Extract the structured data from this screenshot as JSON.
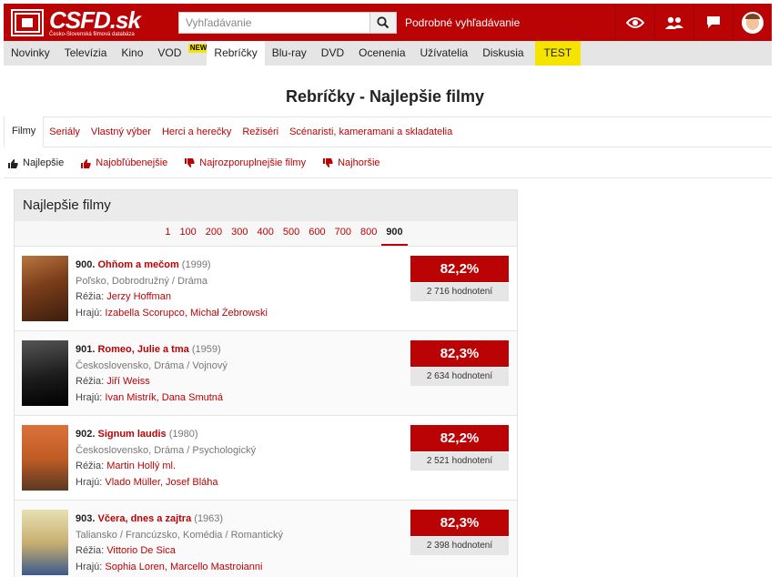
{
  "header": {
    "logo_text": "CSFD.sk",
    "logo_sub": "Česko-Slovenská filmová databáza",
    "search_placeholder": "Vyhľadávanie",
    "advanced_search": "Podrobné vyhľadávanie",
    "icons": [
      "eye-icon",
      "users-icon",
      "chat-icon",
      "avatar"
    ]
  },
  "nav": {
    "items": [
      "Novinky",
      "Televízia",
      "Kino",
      "VOD",
      "Rebríčky",
      "Blu-ray",
      "DVD",
      "Ocenenia",
      "Užívatelia",
      "Diskusia",
      "TEST"
    ],
    "vod_badge": "NEW",
    "active": "Rebríčky"
  },
  "page_title": "Rebríčky - Najlepšie filmy",
  "tabs": [
    "Filmy",
    "Seriály",
    "Vlastný výber",
    "Herci a herečky",
    "Režiséri",
    "Scénaristi, kameramani a skladatelia"
  ],
  "subtabs": [
    "Najlepšie",
    "Najobľúbenejšie",
    "Najrozporuplnejšie filmy",
    "Najhoršie"
  ],
  "box_title": "Najlepšie filmy",
  "pages": [
    "1",
    "100",
    "200",
    "300",
    "400",
    "500",
    "600",
    "700",
    "800",
    "900"
  ],
  "films": [
    {
      "rank": "900.",
      "title": "Ohňom a mečom",
      "year": "(1999)",
      "origin": "Poľsko, Dobrodružný / Dráma",
      "director_label": "Réžia:",
      "director": "Jerzy Hoffman",
      "cast_label": "Hrajú:",
      "cast": "Izabella Scorupco, Michał Żebrowski",
      "rating": "82,2%",
      "votes": "2 716 hodnotení",
      "poster_color": "#8a4b26"
    },
    {
      "rank": "901.",
      "title": "Romeo, Julie a tma",
      "year": "(1959)",
      "origin": "Československo, Dráma / Vojnový",
      "director_label": "Réžia:",
      "director": "Jiří Weiss",
      "cast_label": "Hrajú:",
      "cast": "Ivan Mistrík, Dana Smutná",
      "rating": "82,3%",
      "votes": "2 634 hodnotení",
      "poster_color": "#1e1e1e"
    },
    {
      "rank": "902.",
      "title": "Signum laudis",
      "year": "(1980)",
      "origin": "Československo, Dráma / Psychologický",
      "director_label": "Réžia:",
      "director": "Martin Hollý ml.",
      "cast_label": "Hrajú:",
      "cast": "Vlado Müller, Josef Bláha",
      "rating": "82,2%",
      "votes": "2 521 hodnotení",
      "poster_color": "#c8622b"
    },
    {
      "rank": "903.",
      "title": "Včera, dnes a zajtra",
      "year": "(1963)",
      "origin": "Taliansko / Francúzsko, Komédia / Romantický",
      "director_label": "Réžia:",
      "director": "Vittorio De Sica",
      "cast_label": "Hrajú:",
      "cast": "Sophia Loren, Marcello Mastroianni",
      "rating": "82,3%",
      "votes": "2 398 hodnotení",
      "poster_color": "#d9c98a"
    }
  ]
}
